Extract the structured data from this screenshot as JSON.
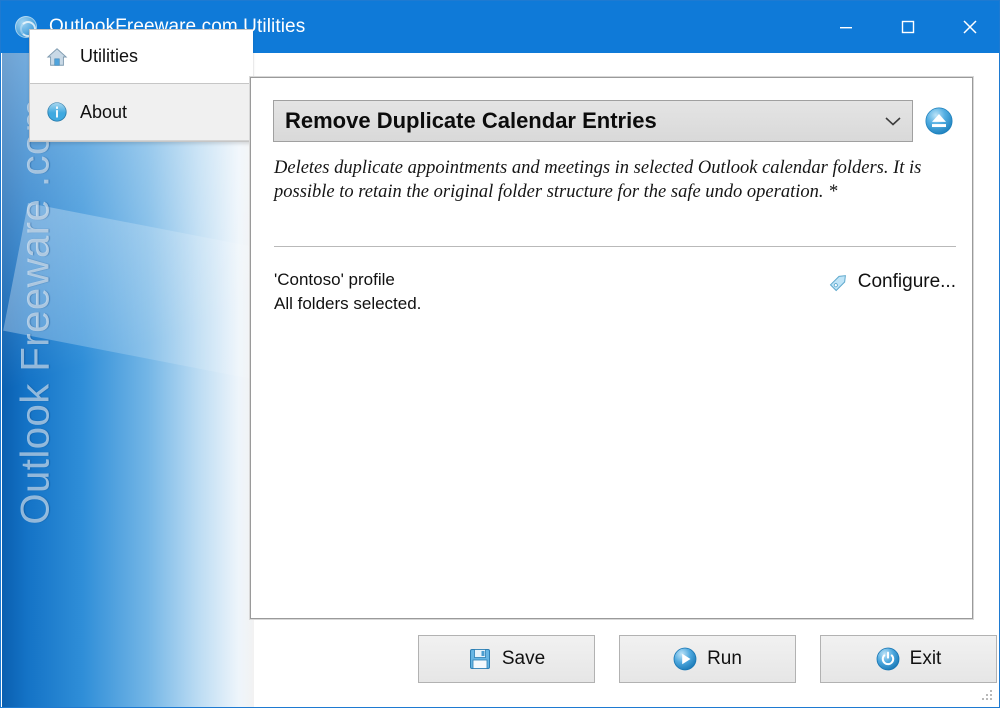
{
  "window": {
    "title": "OutlookFreeware.com Utilities",
    "icon": "globe-icon",
    "minimize_label": "Minimize",
    "maximize_label": "Maximize",
    "close_label": "Close"
  },
  "colors": {
    "titlebar": "#0f7ad8",
    "sidebar_start": "#0a5fb0",
    "sidebar_end": "#f2f2f2",
    "accent": "#3aa4e0",
    "panel_bg": "#ffffff",
    "button_bg": "#eeeeee"
  },
  "sidebar": {
    "watermark": "Outlook Freeware .com",
    "tabs": [
      {
        "label": "Utilities",
        "icon": "home-icon",
        "active": true
      },
      {
        "label": "About",
        "icon": "info-icon",
        "active": false
      }
    ]
  },
  "main": {
    "utility_select": {
      "value": "Remove Duplicate Calendar Entries",
      "arrow_icon": "chevron-down-icon"
    },
    "eject_button": {
      "icon": "eject-icon",
      "label": "Eject"
    },
    "description": "Deletes duplicate appointments and meetings in selected Outlook calendar folders. It is possible to retain the original folder structure for the safe undo operation. *",
    "profile_line": "'Contoso' profile",
    "folders_line": "All folders selected.",
    "configure": {
      "label": "Configure...",
      "icon": "tag-icon"
    }
  },
  "footer": {
    "buttons": [
      {
        "label": "Save",
        "icon": "floppy-disk-icon"
      },
      {
        "label": "Run",
        "icon": "play-icon"
      },
      {
        "label": "Exit",
        "icon": "power-icon"
      }
    ],
    "resize_grip": "resize-grip-icon"
  }
}
